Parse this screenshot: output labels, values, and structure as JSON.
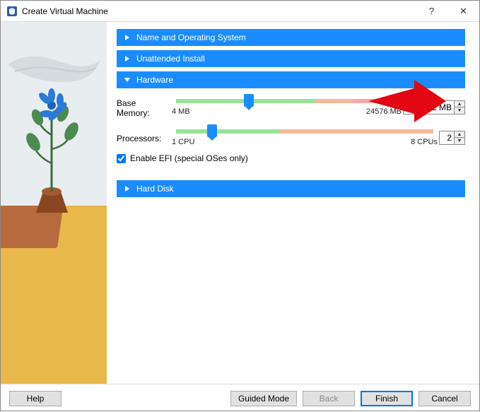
{
  "window": {
    "title": "Create Virtual Machine",
    "help_symbol": "?",
    "close_symbol": "✕"
  },
  "accordions": {
    "name_os": "Name and Operating System",
    "unattended": "Unattended Install",
    "hardware": "Hardware",
    "harddisk": "Hard Disk"
  },
  "hardware": {
    "memory_label": "Base Memory:",
    "memory_value": "8192",
    "memory_unit": "MB",
    "memory_min": "4 MB",
    "memory_max": "24576 MB",
    "proc_label": "Processors:",
    "proc_value": "2",
    "proc_min": "1 CPU",
    "proc_max": "8 CPUs",
    "efi_label": "Enable EFI (special OSes only)"
  },
  "footer": {
    "help": "Help",
    "guided": "Guided Mode",
    "back": "Back",
    "finish": "Finish",
    "cancel": "Cancel"
  }
}
